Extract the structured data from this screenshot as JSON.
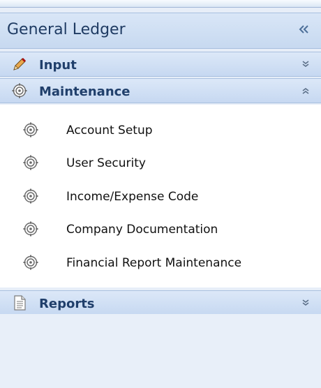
{
  "header": {
    "title": "General Ledger",
    "collapse_icon": "double-chevron-left-icon"
  },
  "sections": [
    {
      "label": "Input",
      "icon": "pencil-icon",
      "state": "collapsed"
    },
    {
      "label": "Maintenance",
      "icon": "gear-icon",
      "state": "expanded"
    },
    {
      "label": "Reports",
      "icon": "document-icon",
      "state": "collapsed"
    }
  ],
  "maintenance_items": [
    {
      "label": "Account Setup",
      "icon": "gear-icon"
    },
    {
      "label": "User Security",
      "icon": "gear-icon"
    },
    {
      "label": "Income/Expense Code",
      "icon": "gear-icon"
    },
    {
      "label": "Company Documentation",
      "icon": "gear-icon"
    },
    {
      "label": "Financial Report Maintenance",
      "icon": "gear-icon"
    }
  ],
  "colors": {
    "header_bg": "#c7d9f0",
    "section_bg": "#c6d8f1",
    "title_text": "#1f3b63",
    "section_text": "#203f6b",
    "panel_bg": "#e7eef8",
    "content_bg": "#ffffff"
  }
}
